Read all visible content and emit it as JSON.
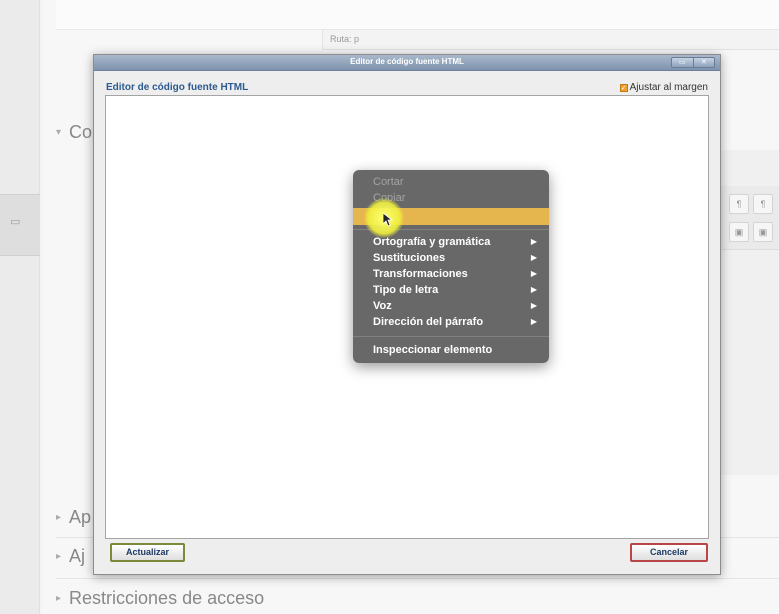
{
  "background": {
    "path_label": "Ruta: p",
    "sections": [
      {
        "label": "Co"
      },
      {
        "label": "Ap"
      },
      {
        "label": "Aj"
      },
      {
        "label": "Restricciones de acceso"
      }
    ]
  },
  "dialog": {
    "window_title": "Editor de código fuente HTML",
    "header": "Editor de código fuente HTML",
    "wrap_label": "Ajustar al margen",
    "wrap_checked": true,
    "update_button": "Actualizar",
    "cancel_button": "Cancelar"
  },
  "context_menu": {
    "items": [
      {
        "label": "Cortar",
        "enabled": false
      },
      {
        "label": "Copiar",
        "enabled": false
      },
      {
        "label": "",
        "highlighted": true
      },
      {
        "label": "Ortografía y gramática",
        "submenu": true
      },
      {
        "label": "Sustituciones",
        "submenu": true
      },
      {
        "label": "Transformaciones",
        "submenu": true
      },
      {
        "label": "Tipo de letra",
        "submenu": true
      },
      {
        "label": "Voz",
        "submenu": true
      },
      {
        "label": "Dirección del párrafo",
        "submenu": true
      },
      {
        "label": "Inspeccionar elemento"
      }
    ]
  },
  "colors": {
    "menu_highlight": "#e6b64e",
    "dialog_header": "#2d5a8f"
  }
}
